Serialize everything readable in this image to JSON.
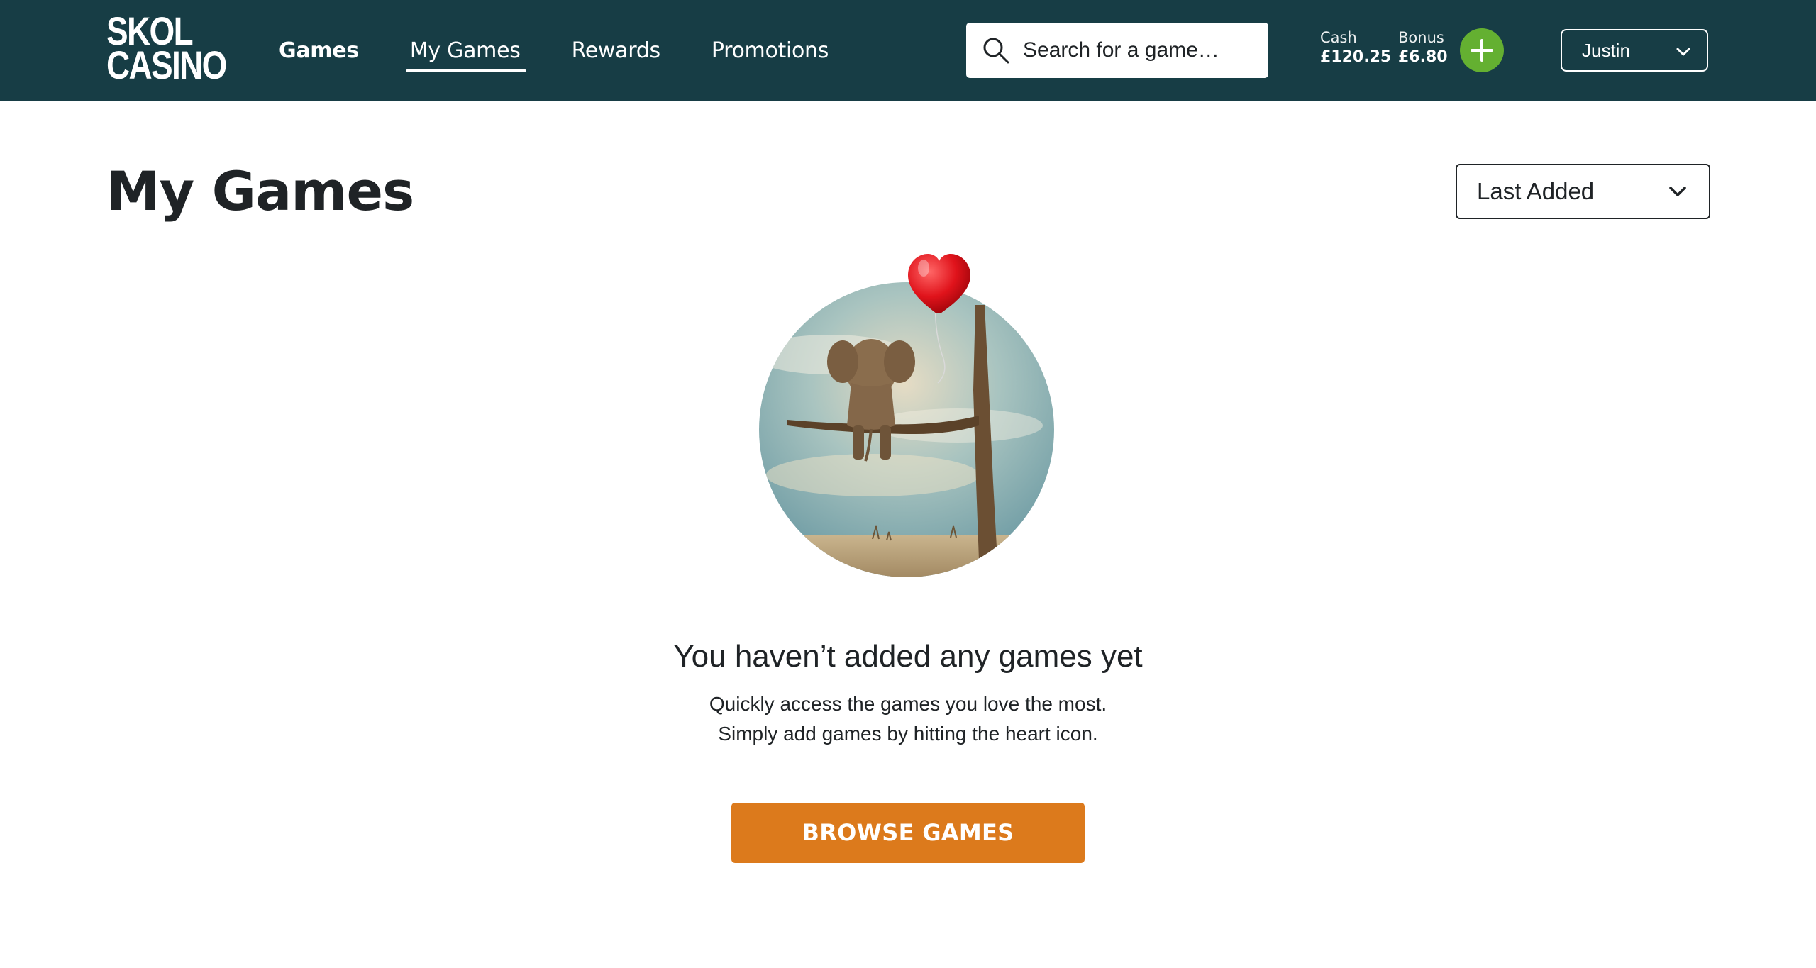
{
  "header": {
    "logo": {
      "line1": "SKOL",
      "line2": "CASINO"
    },
    "nav": [
      {
        "label": "Games"
      },
      {
        "label": "My Games"
      },
      {
        "label": "Rewards"
      },
      {
        "label": "Promotions"
      }
    ],
    "search": {
      "placeholder": "Search for a game…",
      "icon": "search-icon"
    },
    "balance": {
      "cash_label": "Cash",
      "cash_value": "£120.25",
      "bonus_label": "Bonus",
      "bonus_value": "£6.80"
    },
    "deposit_icon": "plus-icon",
    "user": {
      "name": "Justin"
    }
  },
  "main": {
    "title": "My Games",
    "sort": {
      "selected": "Last Added"
    },
    "empty": {
      "title": "You haven’t added any games yet",
      "line1": "Quickly access the games you love the most.",
      "line2": "Simply add games by hitting the heart icon.",
      "button": "BROWSE GAMES"
    }
  },
  "colors": {
    "header_bg": "#173d45",
    "accent_green": "#64b031",
    "cta_orange": "#dc7a1c",
    "text_dark": "#1f2326"
  }
}
